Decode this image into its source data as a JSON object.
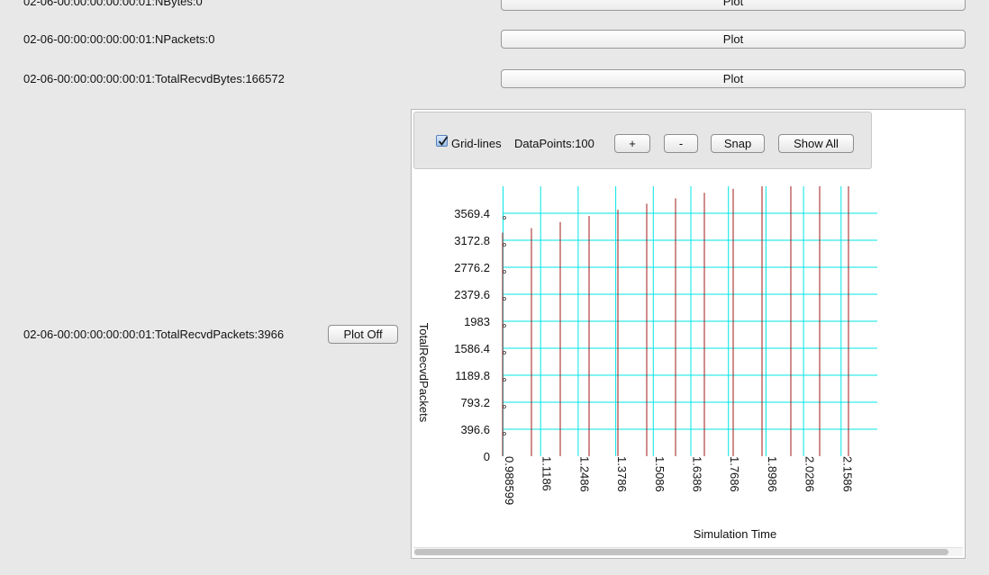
{
  "rows": [
    {
      "label": "02-06-00:00:00:00:00:01:NBytes:0",
      "button": "Plot"
    },
    {
      "label": "02-06-00:00:00:00:00:01:NPackets:0",
      "button": "Plot"
    },
    {
      "label": "02-06-00:00:00:00:00:01:TotalRecvdBytes:166572",
      "button": "Plot"
    }
  ],
  "active_row": {
    "label": "02-06-00:00:00:00:00:01:TotalRecvdPackets:3966",
    "button": "Plot Off"
  },
  "toolbar": {
    "gridlines_label": "Grid-lines",
    "gridlines_checked": true,
    "datapoints_label": "DataPoints:100",
    "plus_label": "+",
    "minus_label": "-",
    "snap_label": "Snap",
    "show_all_label": "Show All"
  },
  "colors": {
    "grid": "#00e5e5",
    "series": "#a01818",
    "background": "#e8e8e8"
  },
  "chart_data": {
    "type": "bar",
    "title": "",
    "xlabel": "Simulation Time",
    "ylabel": "TotalRecvdPackets",
    "y_ticks": [
      "3569.4",
      "3172.8",
      "2776.2",
      "2379.6",
      "1983",
      "1586.4",
      "1189.8",
      "793.2",
      "396.6",
      "0"
    ],
    "x_ticks": [
      "0.988599",
      "1.1186",
      "1.2486",
      "1.3786",
      "1.5086",
      "1.6386",
      "1.7686",
      "1.8986",
      "2.0286",
      "2.1586"
    ],
    "ylim": [
      0,
      3966
    ],
    "xlim": [
      0.988599,
      2.3
    ],
    "grid": true,
    "x": [
      0.988599,
      1.1186,
      1.2486,
      1.3786,
      1.5086,
      1.6386,
      1.7686,
      1.8986,
      2.0286,
      2.1586,
      2.2886
    ],
    "values": [
      3285,
      3350,
      3440,
      3530,
      3620,
      3710,
      3790,
      3870,
      3930,
      3966,
      3966
    ]
  }
}
